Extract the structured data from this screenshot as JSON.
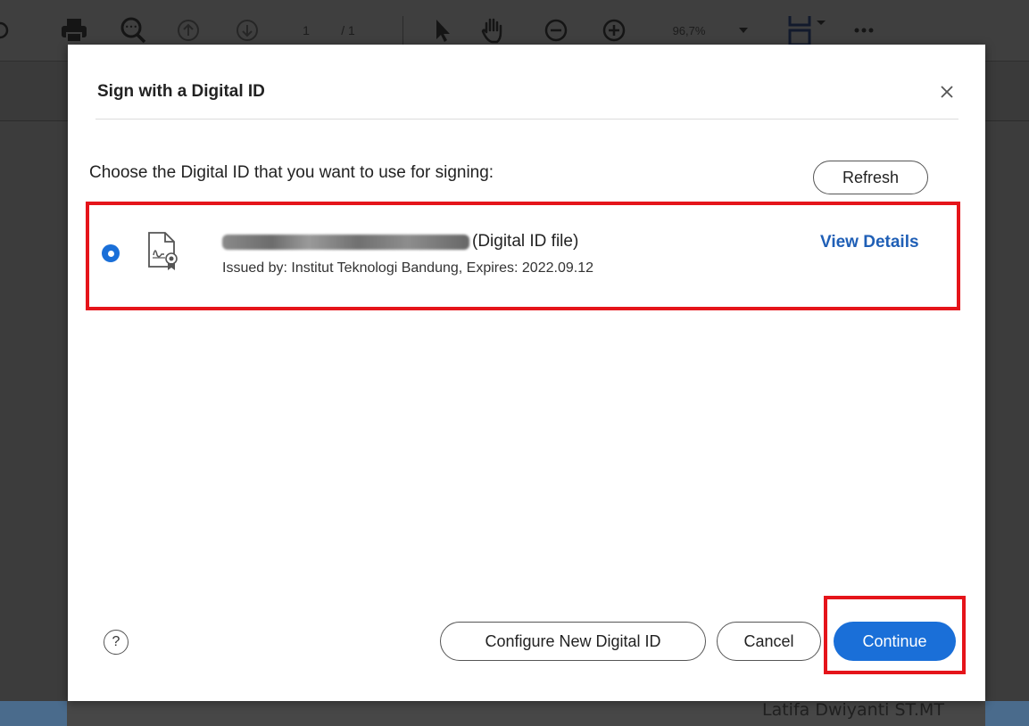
{
  "toolbar": {
    "page_current": "1",
    "page_total": "/ 1",
    "zoom": "96,7%",
    "icons": [
      "print-icon",
      "zoom-search-icon",
      "page-up-icon",
      "page-down-icon",
      "select-arrow-icon",
      "hand-tool-icon",
      "zoom-out-icon",
      "zoom-in-icon",
      "zoom-dropdown-icon",
      "fit-page-icon",
      "more-icon"
    ]
  },
  "background": {
    "signer_name": "Latifa Dwiyanti ST.MT"
  },
  "dialog": {
    "title": "Sign with a Digital ID",
    "close_label": "×",
    "instruction": "Choose the Digital ID that you want to use for signing:",
    "refresh_label": "Refresh",
    "digital_ids": [
      {
        "selected": true,
        "name_suffix": "(Digital ID file)",
        "issuer_line": "Issued by: Institut Teknologi Bandung, Expires: 2022.09.12",
        "view_details_label": "View Details"
      }
    ],
    "help_label": "?",
    "configure_label": "Configure New Digital ID",
    "cancel_label": "Cancel",
    "continue_label": "Continue"
  },
  "colors": {
    "accent": "#1a6fd8",
    "highlight_border": "#e5141a",
    "link": "#1f5fb6"
  }
}
